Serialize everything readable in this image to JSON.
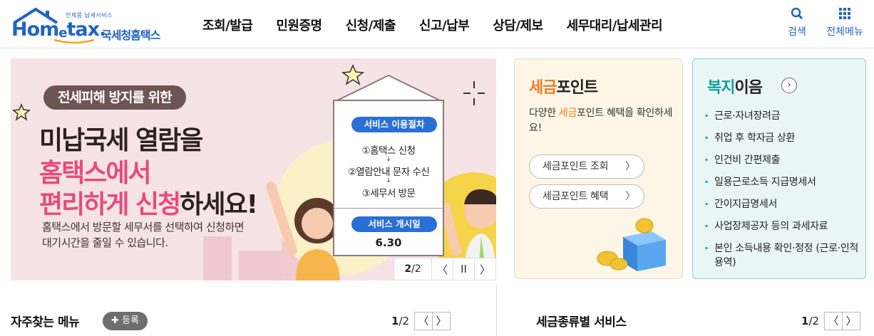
{
  "header": {
    "logo_tagline": "언제쯤 납세서비스",
    "logo_brand_a": "Hom",
    "logo_brand_e": "e",
    "logo_brand_b": "tax.",
    "logo_korean": "국세청홈택스",
    "nav": [
      "조회/발급",
      "민원증명",
      "신청/제출",
      "신고/납부",
      "상담/제보",
      "세무대리/납세관리"
    ],
    "search_label": "검색",
    "all_menu_label": "전체메뉴"
  },
  "banner": {
    "pill": "전세피해 방지를 위한",
    "line1": "미납국세 열람을",
    "line2": "홈택스에서",
    "line3_pink": "편리하게 신청",
    "line3_rest": "하세요!",
    "sub1": "홈택스에서 방문할 세무서를 선택하여 신청하면",
    "sub2": "대기시간을 줄일 수 있습니다.",
    "procedure_title": "서비스 이용절차",
    "steps": [
      "①홈택스 신청",
      "②열람안내 문자 수신",
      "③세무서 방문"
    ],
    "arrow": "↓",
    "open_title": "서비스 개시일",
    "open_date": "6.30",
    "counter_current": "2",
    "counter_total": "/2",
    "prev": "〈",
    "pause": "II",
    "next": "〉"
  },
  "tax_point": {
    "title_accent": "세금",
    "title_rest": "포인트",
    "desc_a": "다양한 ",
    "desc_accent": "세금",
    "desc_b": "포인트 혜택을 확인하세요!",
    "btn1": "세금포인트 조회",
    "btn2": "세금포인트 혜택",
    "chev": "〉"
  },
  "welfare": {
    "title_accent": "복지",
    "title_rest": "이음",
    "arrow": "›",
    "items": [
      "근로·자녀장려금",
      "취업 후 학자금 상환",
      "인건비 간편제출",
      "일용근로소득 지급명세서",
      "간이지급명세서",
      "사업장제공자 등의 과세자료",
      "본인 소득내용 확인·정정 (근로·인적용역)"
    ]
  },
  "freq_menu": {
    "title": "자주찾는 메뉴",
    "register": "✚ 등록",
    "page_current": "1",
    "page_total": "/2",
    "prev": "〈",
    "next": "〉"
  },
  "tax_service": {
    "title": "세금종류별 서비스",
    "page_current": "1",
    "page_total": "/2",
    "prev": "〈",
    "next": "〉"
  },
  "colors": {
    "brand_blue": "#1e64c8",
    "pink": "#e84a7c",
    "orange": "#ee7b22",
    "teal": "#14a0a0"
  }
}
